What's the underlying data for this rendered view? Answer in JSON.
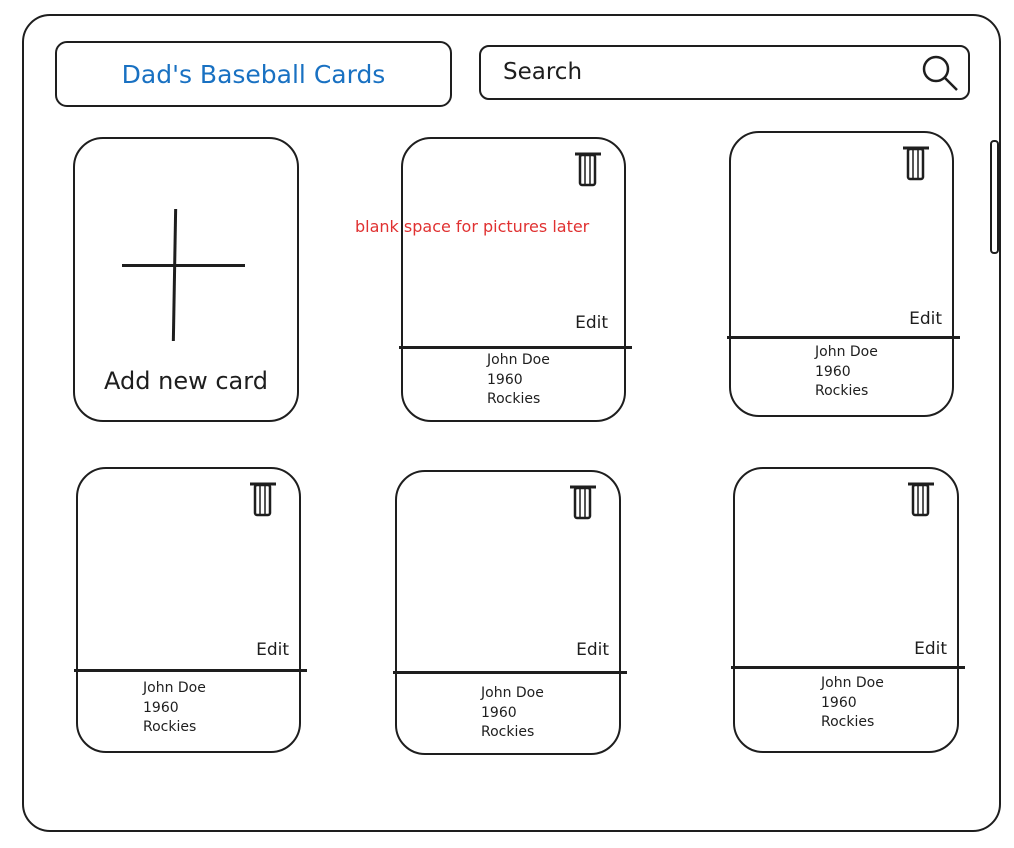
{
  "header": {
    "title": "Dad's Baseball Cards",
    "search_placeholder": "Search"
  },
  "add_card": {
    "label": "Add new card"
  },
  "annotation": "blank space for pictures later",
  "cards": [
    {
      "name": "John Doe",
      "year": "1960",
      "team": "Rockies",
      "edit_label": "Edit"
    },
    {
      "name": "John Doe",
      "year": "1960",
      "team": "Rockies",
      "edit_label": "Edit"
    },
    {
      "name": "John Doe",
      "year": "1960",
      "team": "Rockies",
      "edit_label": "Edit"
    },
    {
      "name": "John Doe",
      "year": "1960",
      "team": "Rockies",
      "edit_label": "Edit"
    },
    {
      "name": "John Doe",
      "year": "1960",
      "team": "Rockies",
      "edit_label": "Edit"
    }
  ],
  "colors": {
    "title": "#1971c2",
    "annotation": "#e03131",
    "stroke": "#1e1e1e"
  }
}
